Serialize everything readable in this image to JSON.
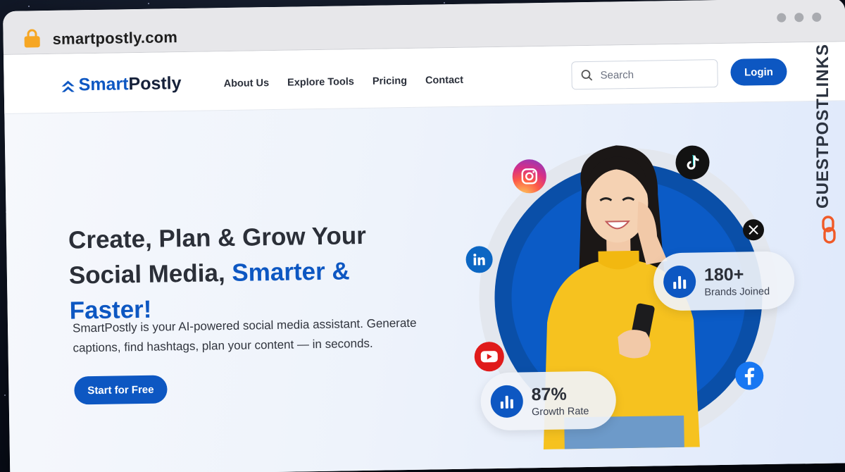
{
  "browser": {
    "url": "smartpostly.com"
  },
  "nav": {
    "logo_text": "SmartPostly",
    "logo_part1": "Smart",
    "logo_part2": "Postly",
    "items": [
      {
        "label": "About Us"
      },
      {
        "label": "Explore Tools"
      },
      {
        "label": "Pricing"
      },
      {
        "label": "Contact"
      }
    ],
    "search_placeholder": "Search",
    "login_label": "Login"
  },
  "hero": {
    "title_part1": "Create, Plan & Grow Your Social Media,",
    "title_highlight": "Smarter & Faster!",
    "subtitle": "SmartPostly is your AI-powered social media assistant. Generate captions, find hashtags, plan your content — in seconds.",
    "cta_label": "Start for Free"
  },
  "stats": {
    "brands": {
      "value": "180+",
      "label": "Brands Joined"
    },
    "growth": {
      "value": "87%",
      "label": "Growth Rate"
    }
  },
  "social_icons": [
    "instagram-icon",
    "tiktok-icon",
    "x-icon",
    "linkedin-icon",
    "youtube-icon",
    "facebook-icon"
  ],
  "watermark": {
    "text": "GUESTPOSTLINKS"
  },
  "colors": {
    "brand": "#0d57c2",
    "text_dark": "#2b2f38",
    "shirt": "#f6c21f"
  }
}
